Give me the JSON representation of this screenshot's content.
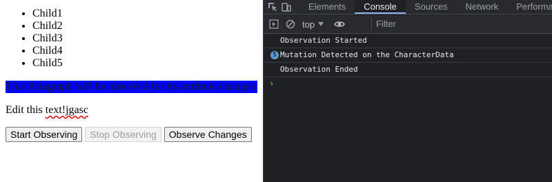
{
  "page": {
    "list_items": [
      "Child1",
      "Child2",
      "Child3",
      "Child4",
      "Child5"
    ],
    "observed_paragraph": "This Paragraph will be observed for its attribute changes",
    "observed_paragraph_bg": "#0000ff",
    "edit_prefix": "Edit this ",
    "edit_word": "text!jgasc",
    "buttons": {
      "start": "Start Observing",
      "stop": "Stop Observing",
      "observe": "Observe Changes"
    }
  },
  "devtools": {
    "tabs": [
      "Elements",
      "Console",
      "Sources",
      "Network",
      "Performance"
    ],
    "active_tab": "Console",
    "context": "top",
    "filter_placeholder": "Filter",
    "messages": [
      {
        "text": "Observation Started",
        "count": null
      },
      {
        "text": "Mutation Detected on the CharacterData",
        "count": "5"
      },
      {
        "text": "Observation Ended",
        "count": null
      }
    ],
    "prompt_symbol": "›"
  }
}
